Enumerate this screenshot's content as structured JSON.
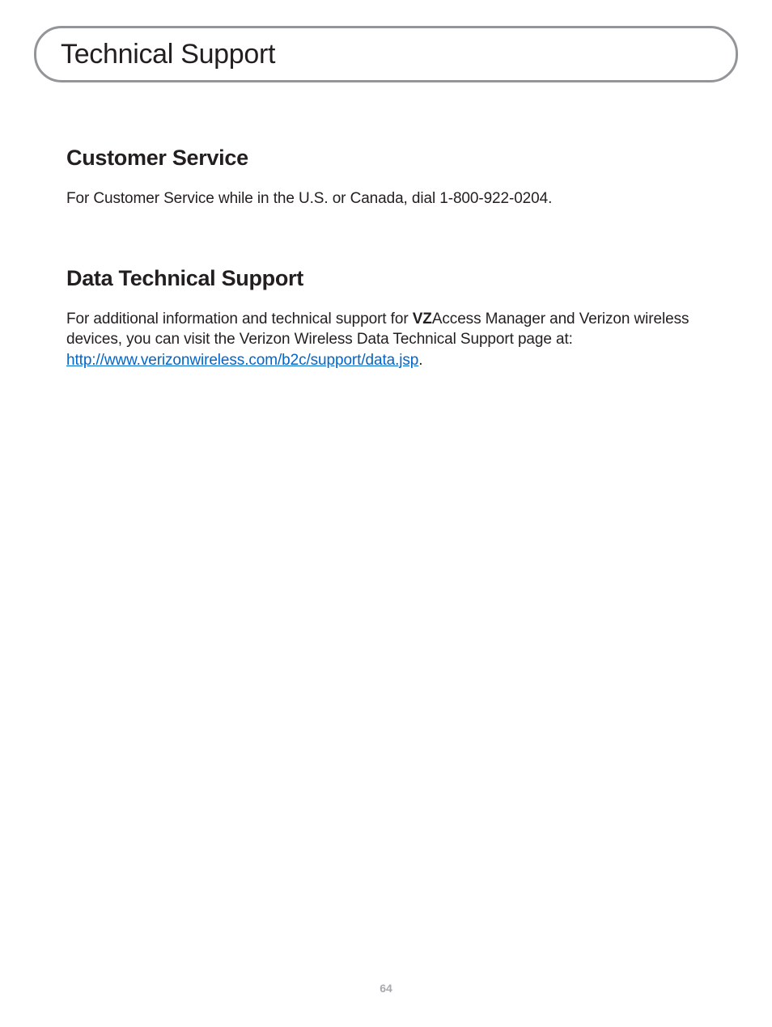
{
  "page_title": "Technical Support",
  "sections": {
    "customer_service": {
      "heading": "Customer Service",
      "body": "For Customer Service while in the U.S. or Canada, dial 1-800-922-0204."
    },
    "data_tech_support": {
      "heading": "Data Technical Support",
      "body_prefix": "For additional information and technical support for ",
      "body_bold": "VZ",
      "body_mid": "Access Manager and Verizon wireless devices, you can visit the Verizon Wireless Data Technical Support page at: ",
      "link_text": "http://www.verizonwireless.com/b2c/support/data.jsp",
      "body_suffix": "."
    }
  },
  "page_number": "64"
}
